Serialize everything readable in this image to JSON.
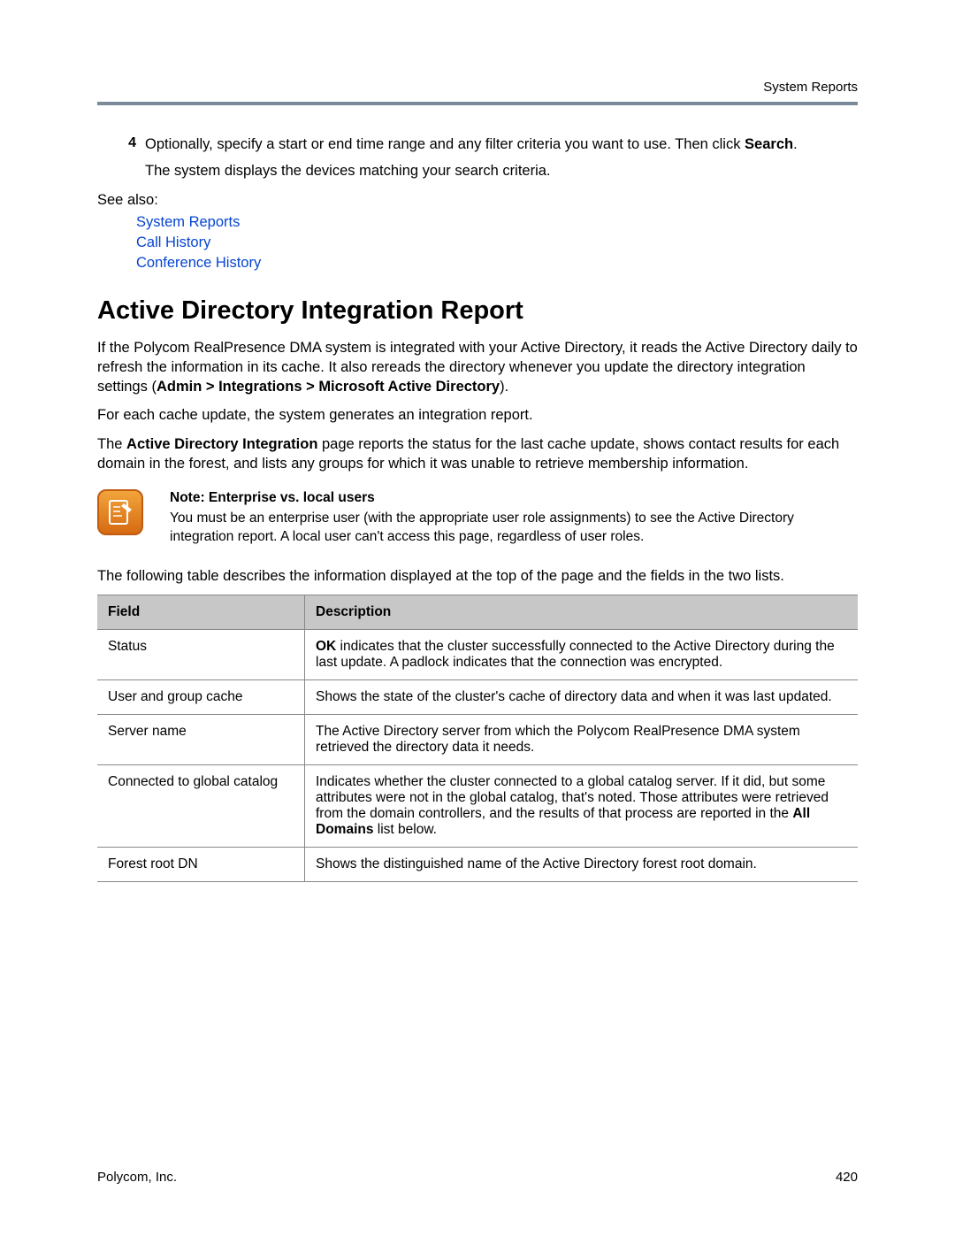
{
  "header": {
    "running_title": "System Reports"
  },
  "step": {
    "number": "4",
    "line1_pre": "Optionally, specify a start or end time range and any filter criteria you want to use. Then click ",
    "line1_bold": "Search",
    "line1_post": ".",
    "sub": "The system displays the devices matching your search criteria."
  },
  "see_also": {
    "label": "See also:",
    "links": [
      "System Reports",
      "Call History",
      "Conference History"
    ]
  },
  "heading": "Active Directory Integration Report",
  "para1": {
    "pre": "If the Polycom RealPresence DMA system is integrated with your Active Directory, it reads the Active Directory daily to refresh the information in its cache. It also rereads the directory whenever you update the directory integration settings (",
    "bold": "Admin > Integrations > Microsoft Active Directory",
    "post": ")."
  },
  "para2": "For each cache update, the system generates an integration report.",
  "para3": {
    "pre": "The ",
    "bold": "Active Directory Integration",
    "post": " page reports the status for the last cache update, shows contact results for each domain in the forest, and lists any groups for which it was unable to retrieve membership information."
  },
  "note": {
    "title": "Note: Enterprise vs. local users",
    "body": "You must be an enterprise user (with the appropriate user role assignments) to see the Active Directory integration report. A local user can't access this page, regardless of user roles."
  },
  "table_intro": "The following table describes the information displayed at the top of the page and the fields in the two lists.",
  "table": {
    "headers": {
      "field": "Field",
      "desc": "Description"
    },
    "rows": [
      {
        "field": "Status",
        "desc_bold": "OK",
        "desc_rest": " indicates that the cluster successfully connected to the Active Directory during the last update. A padlock indicates that the connection was encrypted.",
        "inline_bold": ""
      },
      {
        "field": "User and group cache",
        "desc_bold": "",
        "desc_rest": "Shows the state of the cluster's cache of directory data and when it was last updated.",
        "inline_bold": ""
      },
      {
        "field": "Server name",
        "desc_bold": "",
        "desc_rest": "The Active Directory server from which the Polycom RealPresence DMA system retrieved the directory data it needs.",
        "inline_bold": ""
      },
      {
        "field": "Connected to global catalog",
        "desc_bold": "",
        "desc_rest": "Indicates whether the cluster connected to a global catalog server. If it did, but some attributes were not in the global catalog, that's noted. Those attributes were retrieved from the domain controllers, and the results of that process are reported in the ",
        "inline_bold": "All Domains",
        "tail": " list below."
      },
      {
        "field": "Forest root DN",
        "desc_bold": "",
        "desc_rest": "Shows the distinguished name of the Active Directory forest root domain.",
        "inline_bold": ""
      }
    ]
  },
  "footer": {
    "left": "Polycom, Inc.",
    "right": "420"
  }
}
